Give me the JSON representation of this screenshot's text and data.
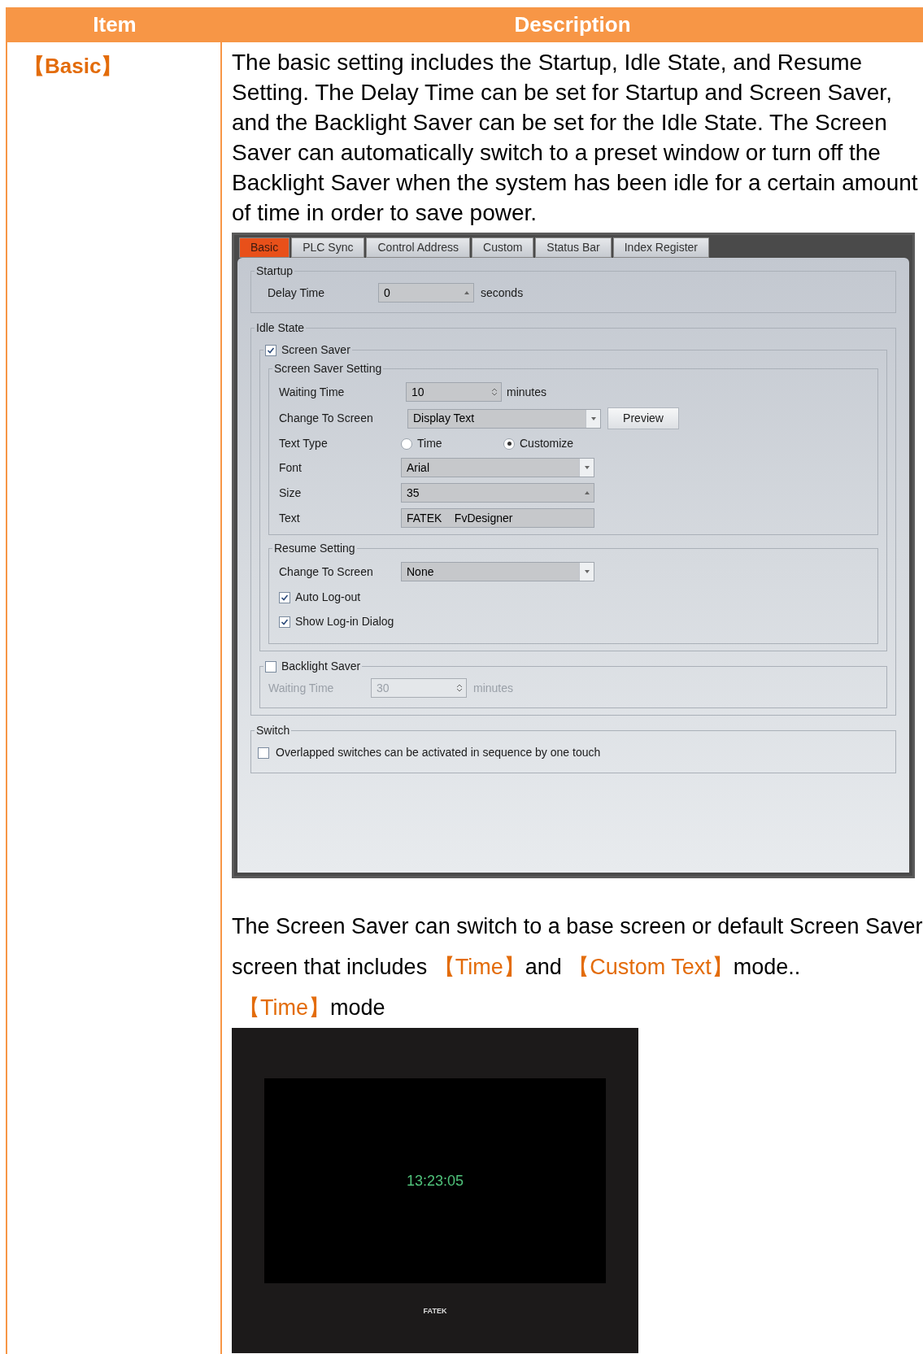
{
  "table": {
    "columns": [
      "Item",
      "Description"
    ],
    "rows": [
      {
        "item": "【Basic】",
        "description": "The basic setting includes the Startup, Idle State, and Resume Setting. The Delay Time can be set for Startup and Screen Saver, and the Backlight Saver can be set for the Idle State. The Screen Saver can automatically switch to a preset window or turn off the Backlight Saver when the system has been idle for a certain amount of time in order to save power.",
        "dialog": {
          "tabs": [
            {
              "label": "Basic",
              "selected": true
            },
            {
              "label": "PLC Sync",
              "selected": false
            },
            {
              "label": "Control Address",
              "selected": false
            },
            {
              "label": "Custom",
              "selected": false
            },
            {
              "label": "Status Bar",
              "selected": false
            },
            {
              "label": "Index Register",
              "selected": false
            }
          ],
          "startup": {
            "title": "Startup",
            "delay_label": "Delay Time",
            "delay_value": "0",
            "unit": "seconds"
          },
          "idle_state": {
            "title": "Idle State",
            "screen_saver": {
              "label": "Screen Saver",
              "checked": true,
              "setting": {
                "title": "Screen Saver Setting",
                "waiting_label": "Waiting Time",
                "waiting_value": "10",
                "waiting_unit": "minutes",
                "change_label": "Change To Screen",
                "change_value": "Display Text",
                "preview_button": "Preview",
                "text_type_label": "Text Type",
                "options": [
                  {
                    "label": "Time",
                    "selected": false
                  },
                  {
                    "label": "Customize",
                    "selected": true
                  }
                ],
                "font_label": "Font",
                "font_value": "Arial",
                "size_label": "Size",
                "size_value": "35",
                "text_label": "Text",
                "text_value": "FATEK    FvDesigner"
              },
              "resume": {
                "title": "Resume Setting",
                "change_label": "Change To Screen",
                "change_value": "None",
                "checks": [
                  {
                    "label": "Auto Log-out",
                    "checked": true
                  },
                  {
                    "label": "Show Log-in Dialog",
                    "checked": true
                  }
                ]
              }
            },
            "backlight": {
              "label": "Backlight Saver",
              "checked": false,
              "disabled": true,
              "waiting_label": "Waiting Time",
              "waiting_value": "30",
              "unit": "minutes"
            }
          },
          "switch": {
            "title": "Switch",
            "checks": [
              {
                "label": "Overlapped switches can be activated in sequence by one touch",
                "checked": false
              }
            ]
          }
        },
        "paragraph": [
          {
            "text": "The Screen Saver can switch to a base screen or default Screen Saver screen that includes",
            "highlight": false
          },
          {
            "text": "【Time】",
            "highlight": true
          },
          {
            "text": "and ",
            "highlight": false
          },
          {
            "text": "【Custom Text】",
            "highlight": true
          },
          {
            "text": "mode..",
            "highlight": false
          }
        ],
        "mode_heading": [
          {
            "text": "【Time】",
            "highlight": true
          },
          {
            "text": "mode",
            "highlight": false
          }
        ],
        "preview": {
          "clock": "13:23:05",
          "logo": "FATEK"
        }
      }
    ]
  }
}
